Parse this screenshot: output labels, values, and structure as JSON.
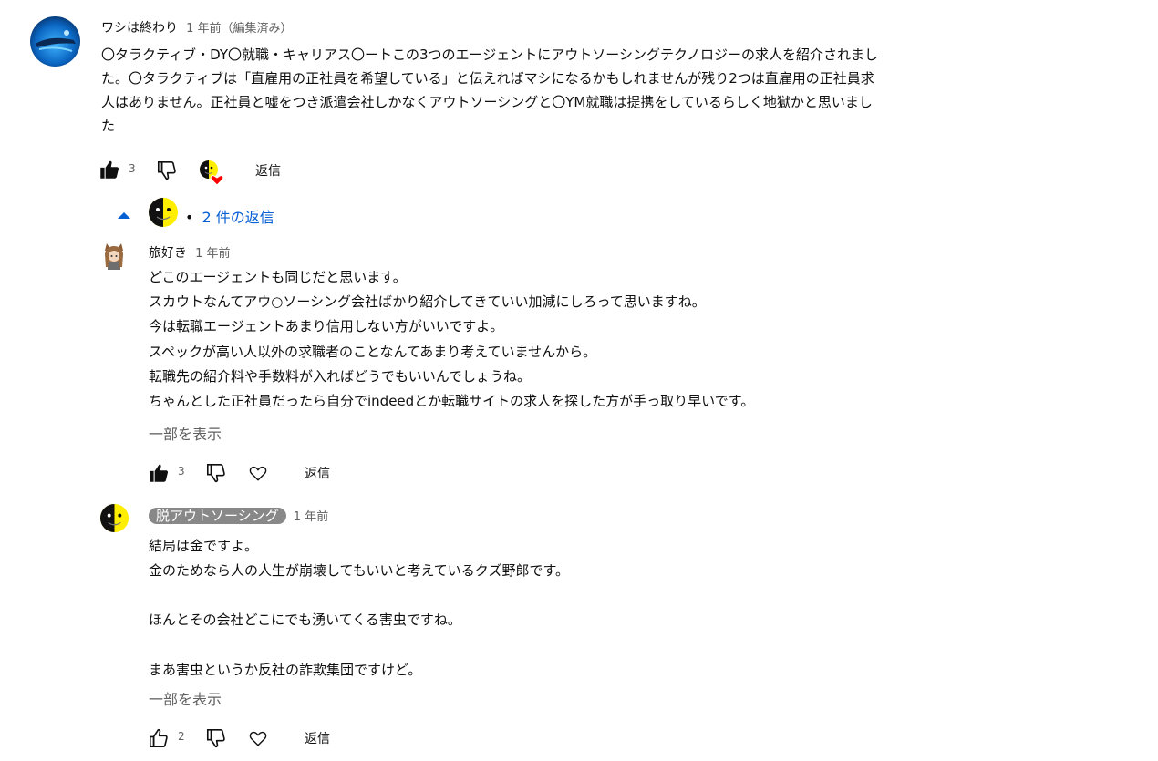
{
  "comment": {
    "author": "ワシは終わり",
    "time": "1 年前（編集済み）",
    "lines": [
      "〇タラクティブ・DY〇就職・キャリアス〇ートこの3つのエージェントにアウトソーシングテクノロジーの求人を紹介されまし",
      "た。〇タラクティブは「直雇用の正社員を希望している」と伝えればマシになるかもしれませんが残り2つは直雇用の正社員求",
      "人はありません。正社員と嘘をつき派遣会社しかなくアウトソーシングと〇YM就職は提携をしているらしく地獄かと思いまし",
      "た"
    ],
    "likes": "3",
    "reply_label": "返信"
  },
  "replies_toggle": {
    "label": "2 件の返信",
    "bullet": "•"
  },
  "replies": [
    {
      "author": "旅好き",
      "time": "1 年前",
      "lines": [
        "どこのエージェントも同じだと思います。",
        "スカウトなんてアウ○ソーシング会社ばかり紹介してきていい加減にしろって思いますね。",
        "今は転職エージェントあまり信用しない方がいいですよ。",
        "スペックが高い人以外の求職者のことなんてあまり考えていませんから。",
        "転職先の紹介料や手数料が入ればどうでもいいんでしょうね。",
        "ちゃんとした正社員だったら自分でindeedとか転職サイトの求人を探した方が手っ取り早いです。"
      ],
      "show_more": "一部を表示",
      "likes": "3",
      "reply_label": "返信"
    },
    {
      "author": "脱アウトソーシング",
      "time": "1 年前",
      "lines": [
        "結局は金ですよ。",
        "金のためなら人の人生が崩壊してもいいと考えているクズ野郎です。",
        "",
        "ほんとその会社どこにでも湧いてくる害虫ですね。",
        "",
        "まあ害虫というか反社の詐欺集団ですけど。"
      ],
      "show_more": "一部を表示",
      "likes": "2",
      "reply_label": "返信"
    }
  ],
  "icons": {
    "like": "thumbs-up-icon",
    "dislike": "thumbs-down-icon",
    "heart": "heart-icon",
    "creator_heart": "creator-heart-icon",
    "collapse": "caret-up-icon"
  },
  "colors": {
    "link_blue": "#065fd4",
    "text": "#0f0f0f",
    "secondary": "#606060",
    "badge_bg": "#888888",
    "heart_red": "#ff0000",
    "face_yellow": "#ffee00"
  }
}
